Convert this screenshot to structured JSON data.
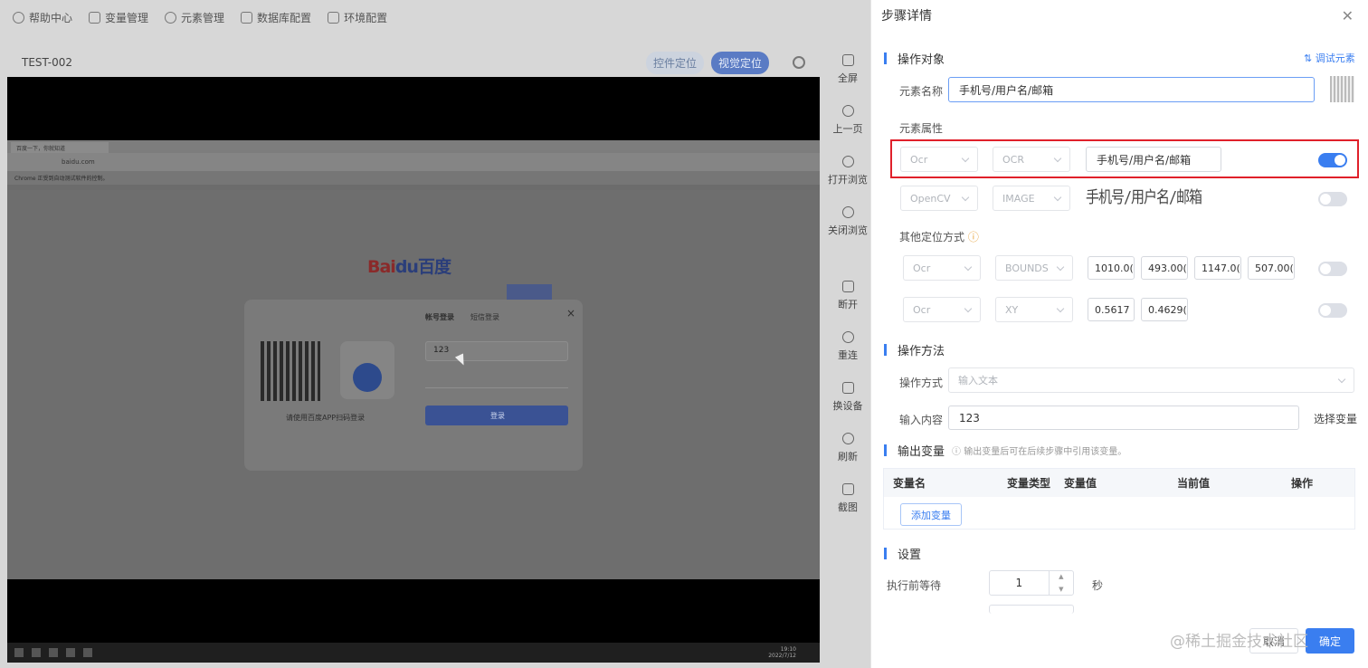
{
  "topnav": {
    "items": [
      {
        "label": "帮助中心",
        "icon": "help-icon"
      },
      {
        "label": "变量管理",
        "icon": "database-icon"
      },
      {
        "label": "元素管理",
        "icon": "element-icon"
      },
      {
        "label": "数据库配置",
        "icon": "database-icon"
      },
      {
        "label": "环境配置",
        "icon": "settings-window-icon"
      }
    ]
  },
  "device": {
    "title": "TEST-002",
    "seg_control": "控件定位",
    "seg_visual": "视觉定位"
  },
  "tools": [
    {
      "label": "全屏",
      "icon": "fullscreen-icon"
    },
    {
      "label": "上一页",
      "icon": "back-icon"
    },
    {
      "label": "打开浏览",
      "icon": "open-browser-icon"
    },
    {
      "label": "关闭浏览",
      "icon": "power-icon"
    },
    {
      "label": "断开",
      "icon": "disconnect-icon"
    },
    {
      "label": "重连",
      "icon": "link-icon"
    },
    {
      "label": "换设备",
      "icon": "swap-icon"
    },
    {
      "label": "刷新",
      "icon": "refresh-icon"
    },
    {
      "label": "截图",
      "icon": "crop-icon"
    }
  ],
  "browser": {
    "tab": "百度一下，你就知道",
    "url": "baidu.com",
    "info": "Chrome 正受到自动测试软件的控制。",
    "logo_a": "Bai",
    "logo_b": "du百度",
    "modal": {
      "tab1": "帐号登录",
      "tab2": "短信登录",
      "input": "123",
      "scan": "请使用百度APP扫码登录",
      "login": "登录"
    }
  },
  "taskbar": {
    "time": "19:10",
    "date": "2022/7/12"
  },
  "drawer": {
    "title": "步骤详情",
    "op_target": "操作对象",
    "debug": "调试元素",
    "elem_name_label": "元素名称",
    "elem_name": "手机号/用户名/邮箱",
    "elem_attr_label": "元素属性",
    "row1": {
      "a": "Ocr",
      "b": "OCR",
      "c": "手机号/用户名/邮箱",
      "enabled": true
    },
    "row2": {
      "a": "OpenCV",
      "b": "IMAGE",
      "img_text": "手机号/用户名/邮箱",
      "enabled": false
    },
    "other_label": "其他定位方式",
    "row3": {
      "a": "Ocr",
      "b": "BOUNDS",
      "v1": "1010.0(",
      "v2": "493.00(",
      "v3": "1147.0(",
      "v4": "507.00(",
      "enabled": false
    },
    "row4": {
      "a": "Ocr",
      "b": "XY",
      "v1": "0.5617",
      "v2": "0.4629(",
      "enabled": false
    },
    "op_method": "操作方法",
    "op_mode_label": "操作方式",
    "op_mode": "输入文本",
    "input_label": "输入内容",
    "input_value": "123",
    "pick_var": "选择变量",
    "output_var": "输出变量",
    "output_hint": "输出变量后可在后续步骤中引用该变量。",
    "cols": [
      "变量名",
      "变量类型",
      "变量值",
      "当前值",
      "操作"
    ],
    "add_var": "添加变量",
    "settings": "设置",
    "wait_label": "执行前等待",
    "wait_value": "1",
    "wait_unit": "秒",
    "cancel": "取消",
    "ok": "确定",
    "watermark": "@稀土掘金技术社区"
  },
  "colors": {
    "accent": "#3a7ef0",
    "highlight": "#e0202a"
  }
}
